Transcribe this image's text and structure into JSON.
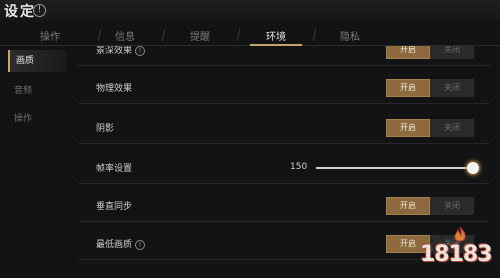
{
  "window": {
    "title": "设定",
    "info_icon": "!"
  },
  "tabs": [
    {
      "label": "操作",
      "active": false
    },
    {
      "label": "信息",
      "active": false
    },
    {
      "label": "提醒",
      "active": false
    },
    {
      "label": "环境",
      "active": true
    },
    {
      "label": "隐私",
      "active": false
    }
  ],
  "sidebar": {
    "items": [
      {
        "label": "画质",
        "active": true
      },
      {
        "label": "音频",
        "active": false
      },
      {
        "label": "操作",
        "active": false
      }
    ]
  },
  "settings": {
    "on_label": "开启",
    "off_label": "关闭",
    "rows": [
      {
        "label": "景深效果",
        "help": true,
        "type": "toggle",
        "value": "on"
      },
      {
        "label": "物理效果",
        "help": false,
        "type": "toggle",
        "value": "on"
      },
      {
        "label": "阴影",
        "help": false,
        "type": "toggle",
        "value": "on"
      },
      {
        "label": "帧率设置",
        "help": false,
        "type": "slider",
        "value": "150",
        "level": 1.0
      },
      {
        "label": "垂直同步",
        "help": false,
        "type": "toggle",
        "value": "on"
      },
      {
        "label": "最低画质",
        "help": true,
        "type": "toggle",
        "value": "on"
      }
    ]
  },
  "watermark": {
    "text": "18183"
  },
  "colors": {
    "accent": "#c8a36a",
    "toggle_on": "#8c6a3e",
    "background": "#121314"
  }
}
